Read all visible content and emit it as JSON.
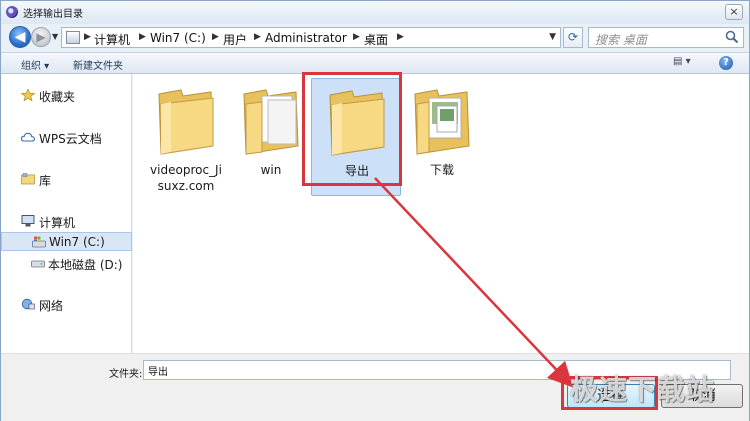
{
  "window": {
    "title": "选择输出目录",
    "close_label": "×"
  },
  "nav": {
    "breadcrumbs": [
      "计算机",
      "Win7 (C:)",
      "用户",
      "Administrator",
      "桌面"
    ],
    "search_placeholder": "搜索 桌面"
  },
  "toolbar": {
    "organize": "组织 ▾",
    "new_folder": "新建文件夹",
    "help": "?"
  },
  "sidebar": {
    "items": [
      {
        "label": "收藏夹",
        "icon": "star-icon"
      },
      {
        "label": "WPS云文档",
        "icon": "cloud-icon"
      },
      {
        "label": "库",
        "icon": "library-icon"
      },
      {
        "label": "计算机",
        "icon": "computer-icon"
      },
      {
        "label": "Win7 (C:)",
        "icon": "drive-c-icon"
      },
      {
        "label": "本地磁盘 (D:)",
        "icon": "drive-d-icon"
      },
      {
        "label": "网络",
        "icon": "network-icon"
      }
    ]
  },
  "files": [
    {
      "name": "videoproc_Jisuxz.com",
      "name_line1": "videoproc_Ji",
      "name_line2": "suxz.com"
    },
    {
      "name": "win"
    },
    {
      "name": "导出",
      "selected": true
    },
    {
      "name": "下载"
    }
  ],
  "footer": {
    "folder_label": "文件夹:",
    "folder_value": "导出",
    "ok_label": "选择",
    "cancel_label": "取消"
  },
  "watermark": "极速下载站",
  "colors": {
    "highlight": "#d9363e",
    "selection": "#cce0f7",
    "folder": "#f6d77a"
  }
}
